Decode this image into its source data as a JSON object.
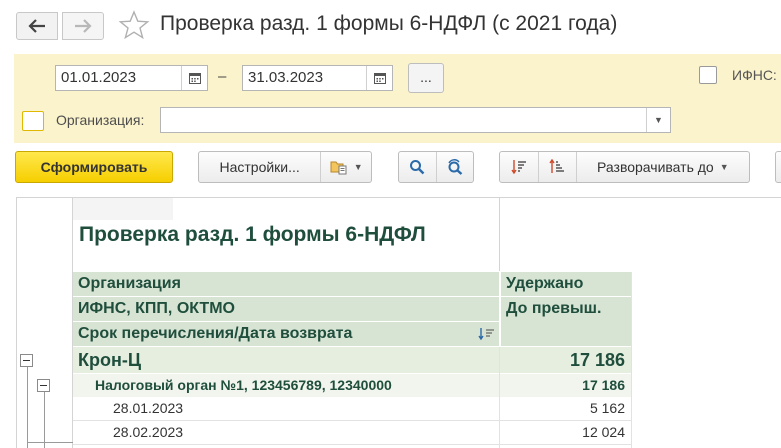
{
  "window": {
    "title": "Проверка разд. 1 формы 6-НДФЛ (с 2021 года)"
  },
  "filters": {
    "date_from": "01.01.2023",
    "date_separator": "–",
    "date_to": "31.03.2023",
    "period_button": "...",
    "ifns_label": "ИФНС:",
    "org_label": "Организация:",
    "org_value": ""
  },
  "toolbar": {
    "generate": "Сформировать",
    "settings": "Настройки...",
    "expand_to": "Разворачивать до"
  },
  "report": {
    "title": "Проверка разд. 1 формы 6-НДФЛ",
    "headers": {
      "col1": [
        "Организация",
        "ИФНС, КПП, ОКТМО",
        "Срок перечисления/Дата возврата"
      ],
      "col2": [
        "Удержано",
        "До превыш."
      ]
    },
    "rows": [
      {
        "level": 0,
        "label": "Крон-Ц",
        "value": "17 186"
      },
      {
        "level": 1,
        "label": "Налоговый орган №1, 123456789, 12340000",
        "value": "17 186"
      },
      {
        "level": 2,
        "label": "28.01.2023",
        "value": "5 162"
      },
      {
        "level": 2,
        "label": "28.02.2023",
        "value": "12 024"
      }
    ]
  },
  "colors": {
    "accent_yellow": "#f6cf00",
    "filter_panel": "#fbf3cc",
    "header_green": "#d8e4d3",
    "group_green": "#e6eedf",
    "text_green": "#1f4e3d"
  }
}
